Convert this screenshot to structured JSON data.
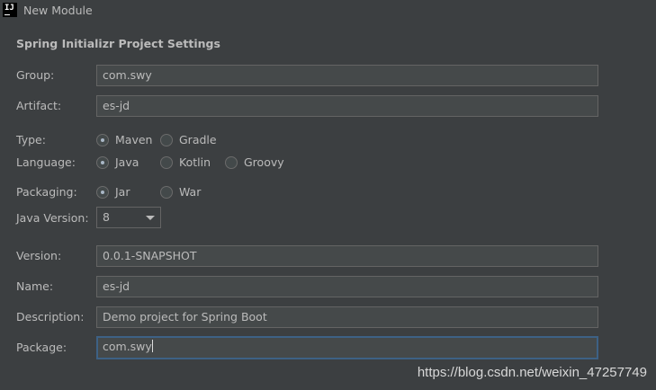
{
  "window": {
    "title": "New Module",
    "app_icon": "IJ"
  },
  "section_title": "Spring Initializr Project Settings",
  "fields": {
    "group": {
      "label": "Group:",
      "value": "com.swy"
    },
    "artifact": {
      "label": "Artifact:",
      "value": "es-jd"
    },
    "version": {
      "label": "Version:",
      "value": "0.0.1-SNAPSHOT"
    },
    "name": {
      "label": "Name:",
      "value": "es-jd"
    },
    "description": {
      "label": "Description:",
      "value": "Demo project for Spring Boot"
    },
    "package": {
      "label": "Package:",
      "value": "com.swy"
    }
  },
  "type": {
    "label": "Type:",
    "options": [
      "Maven",
      "Gradle"
    ],
    "selected": "Maven"
  },
  "language": {
    "label": "Language:",
    "options": [
      "Java",
      "Kotlin",
      "Groovy"
    ],
    "selected": "Java"
  },
  "packaging": {
    "label": "Packaging:",
    "options": [
      "Jar",
      "War"
    ],
    "selected": "Jar"
  },
  "java_version": {
    "label": "Java Version:",
    "value": "8"
  },
  "watermark": "https://blog.csdn.net/weixin_47257749",
  "colors": {
    "background": "#3c3f41",
    "field_bg": "#45494a",
    "field_border": "#646464",
    "focus_border": "#3d6185",
    "text": "#bbbbbb"
  }
}
